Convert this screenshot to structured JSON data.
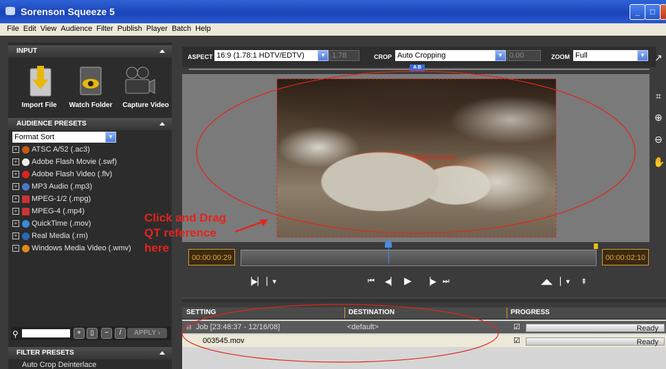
{
  "window": {
    "title": "Sorenson Squeeze 5"
  },
  "menu": [
    "File",
    "Edit",
    "View",
    "Audience",
    "Filter",
    "Publish",
    "Player",
    "Batch",
    "Help"
  ],
  "input": {
    "header": "INPUT",
    "buttons": [
      {
        "label": "Import File",
        "icon": "import-file-icon"
      },
      {
        "label": "Watch Folder",
        "icon": "watch-folder-icon"
      },
      {
        "label": "Capture Video",
        "icon": "capture-video-icon"
      }
    ]
  },
  "audience": {
    "header": "AUDIENCE PRESETS",
    "sort": "Format Sort",
    "presets": [
      "ATSC A/52 (.ac3)",
      "Adobe Flash Movie (.swf)",
      "Adobe Flash Video (.flv)",
      "MP3 Audio (.mp3)",
      "MPEG-1/2 (.mpg)",
      "MPEG-4 (.mp4)",
      "QuickTime (.mov)",
      "Real Media (.rm)",
      "Windows Media Video (.wmv)"
    ],
    "apply": "APPLY"
  },
  "filter": {
    "header": "FILTER PRESETS",
    "first": "Auto Crop Deinterlace"
  },
  "toolbar": {
    "aspect_label": "ASPECT",
    "aspect_value": "16:9 (1.78:1 HDTV/EDTV)",
    "aspect_num": "1.78",
    "crop_label": "CROP",
    "crop_value": "Auto Cropping",
    "crop_num": "0.00",
    "zoom_label": "ZOOM",
    "zoom_value": "Full",
    "ab": "A B"
  },
  "timeline": {
    "in": "00:00:00:29",
    "out": "00:00:02:10"
  },
  "annotation": {
    "line1": "Click and Drag",
    "line2": "QT reference",
    "line3": "here"
  },
  "overlay_text": "Original photo",
  "jobs": {
    "headers": {
      "setting": "SETTING",
      "destination": "DESTINATION",
      "progress": "PROGRESS"
    },
    "rows": [
      {
        "setting": "Job [23:48:37 - 12/16/08]",
        "destination": "<default>",
        "status": "Ready"
      },
      {
        "setting": "003545.mov",
        "destination": "",
        "status": "Ready"
      }
    ]
  },
  "colors": {
    "accent": "#2a58cf",
    "annotation": "#e3241b",
    "timecode": "#e8a33b"
  }
}
